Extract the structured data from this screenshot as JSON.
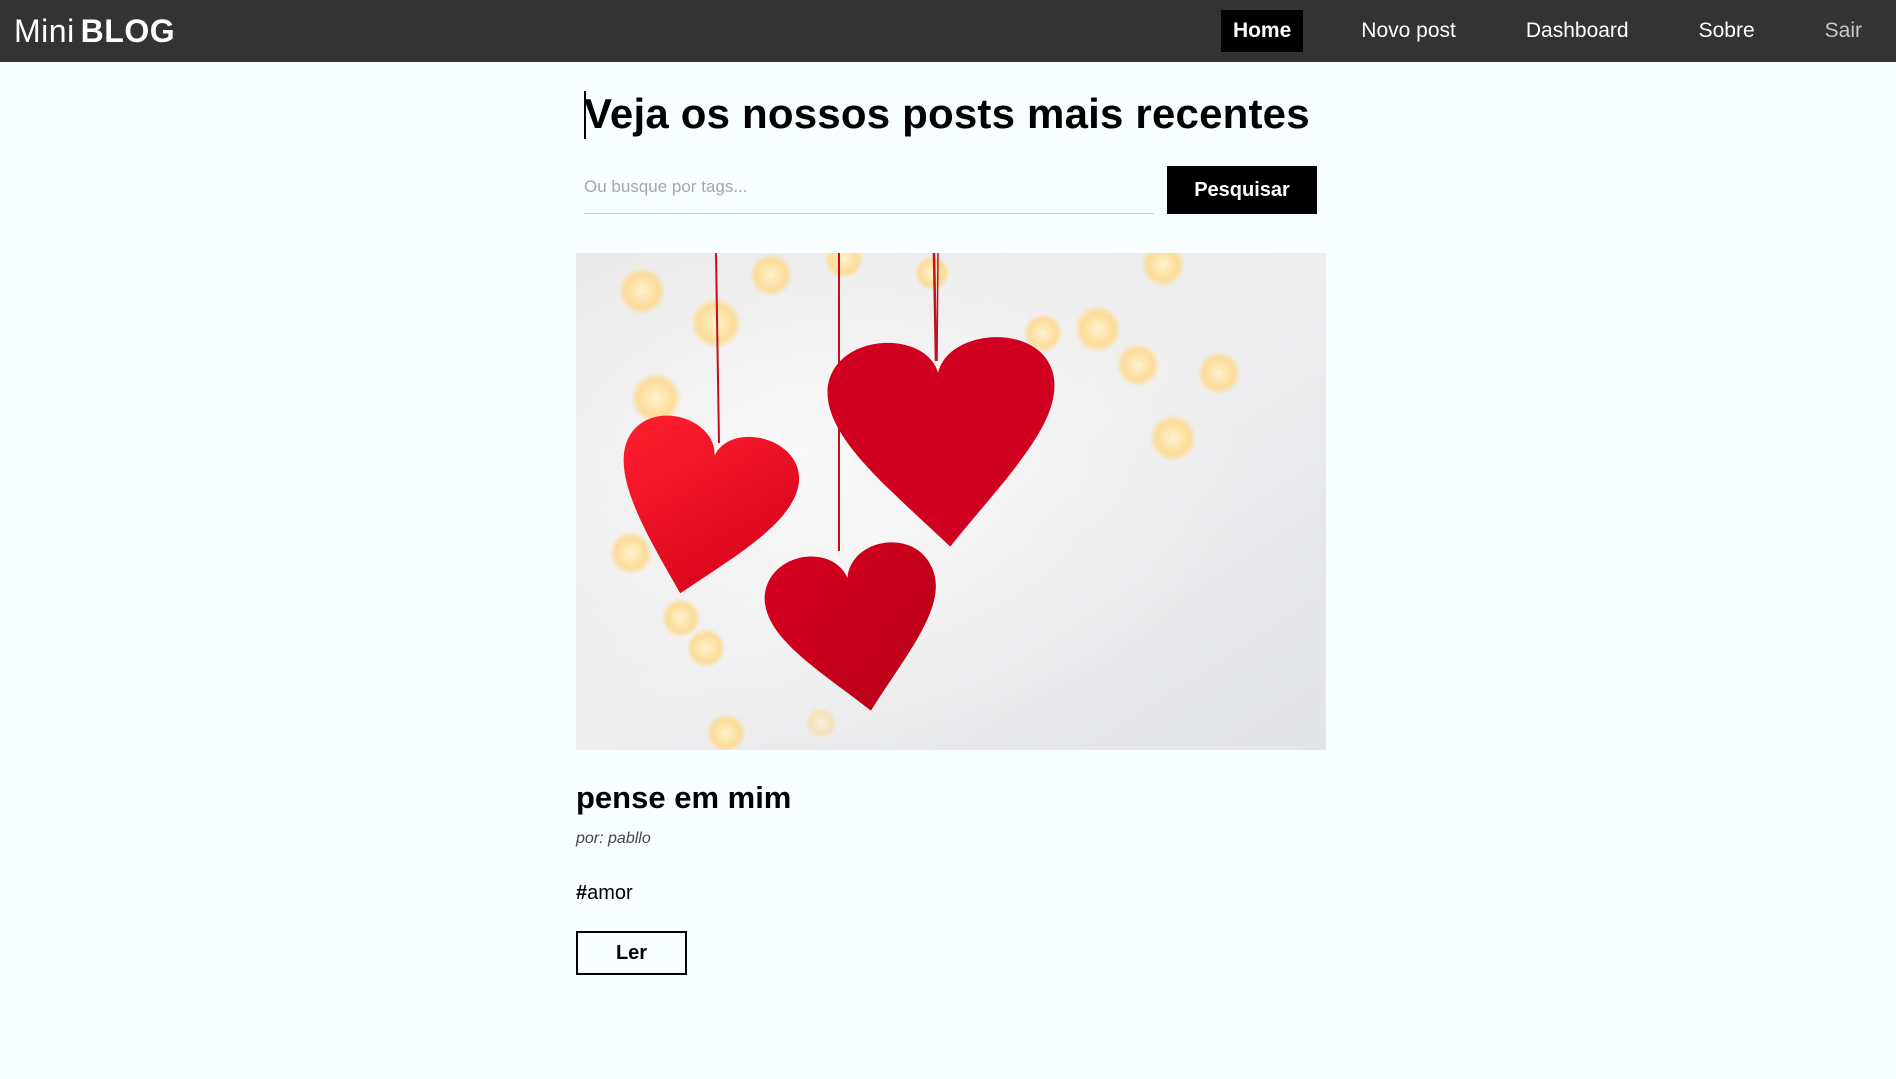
{
  "navbar": {
    "brand_light": "Mini",
    "brand_bold": "BLOG",
    "links": [
      {
        "label": "Home",
        "active": true
      },
      {
        "label": "Novo post",
        "active": false
      },
      {
        "label": "Dashboard",
        "active": false
      },
      {
        "label": "Sobre",
        "active": false
      },
      {
        "label": "Sair",
        "active": false
      }
    ]
  },
  "home": {
    "title": "Veja os nossos posts mais recentes",
    "search": {
      "placeholder": "Ou busque por tags...",
      "value": "",
      "button_label": "Pesquisar"
    }
  },
  "posts": [
    {
      "title": "pense em mim",
      "author": "por: pabllo",
      "tags": [
        {
          "hash": "#",
          "name": "amor"
        }
      ],
      "read_label": "Ler",
      "image_icon": "red-hearts-photo"
    }
  ],
  "colors": {
    "navbar_bg": "#333333",
    "page_bg": "#f8fdff",
    "accent": "#000000",
    "heart_red": "#d4001c"
  }
}
